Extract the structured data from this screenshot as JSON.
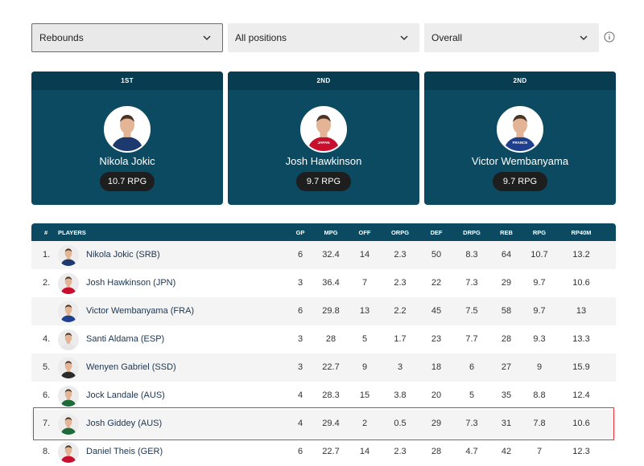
{
  "filters": {
    "stat": "Rebounds",
    "position": "All positions",
    "scope": "Overall"
  },
  "leaders": [
    {
      "rank": "1ST",
      "name": "Nikola Jokic",
      "stat": "10.7 RPG",
      "jersey_color": "#1c3a6e",
      "jersey_text": ""
    },
    {
      "rank": "2ND",
      "name": "Josh Hawkinson",
      "stat": "9.7 RPG",
      "jersey_color": "#c8102e",
      "jersey_text": "JAPAN"
    },
    {
      "rank": "2ND",
      "name": "Victor Wembanyama",
      "stat": "9.7 RPG",
      "jersey_color": "#1f3f8f",
      "jersey_text": "FRANCE"
    }
  ],
  "table": {
    "headers": [
      "#",
      "PLAYERS",
      "GP",
      "MPG",
      "OFF",
      "ORPG",
      "DEF",
      "DRPG",
      "REB",
      "RPG",
      "RP40M"
    ],
    "rows": [
      {
        "rank": "1.",
        "player": "Nikola Jokic (SRB)",
        "gp": "6",
        "mpg": "32.4",
        "off": "14",
        "orpg": "2.3",
        "def": "50",
        "drpg": "8.3",
        "reb": "64",
        "rpg": "10.7",
        "rp40m": "13.2",
        "jersey": "#1c3a6e"
      },
      {
        "rank": "2.",
        "player": "Josh Hawkinson (JPN)",
        "gp": "3",
        "mpg": "36.4",
        "off": "7",
        "orpg": "2.3",
        "def": "22",
        "drpg": "7.3",
        "reb": "29",
        "rpg": "9.7",
        "rp40m": "10.6",
        "jersey": "#c8102e"
      },
      {
        "rank": "",
        "player": "Victor Wembanyama (FRA)",
        "gp": "6",
        "mpg": "29.8",
        "off": "13",
        "orpg": "2.2",
        "def": "45",
        "drpg": "7.5",
        "reb": "58",
        "rpg": "9.7",
        "rp40m": "13",
        "jersey": "#1f3f8f"
      },
      {
        "rank": "4.",
        "player": "Santi Aldama (ESP)",
        "gp": "3",
        "mpg": "28",
        "off": "5",
        "orpg": "1.7",
        "def": "23",
        "drpg": "7.7",
        "reb": "28",
        "rpg": "9.3",
        "rp40m": "13.3",
        "jersey": "#e6e6e6"
      },
      {
        "rank": "5.",
        "player": "Wenyen Gabriel (SSD)",
        "gp": "3",
        "mpg": "22.7",
        "off": "9",
        "orpg": "3",
        "def": "18",
        "drpg": "6",
        "reb": "27",
        "rpg": "9",
        "rp40m": "15.9",
        "jersey": "#2b2b2b"
      },
      {
        "rank": "6.",
        "player": "Jock Landale (AUS)",
        "gp": "4",
        "mpg": "28.3",
        "off": "15",
        "orpg": "3.8",
        "def": "20",
        "drpg": "5",
        "reb": "35",
        "rpg": "8.8",
        "rp40m": "12.4",
        "jersey": "#1e6b3a"
      },
      {
        "rank": "7.",
        "player": "Josh Giddey (AUS)",
        "gp": "4",
        "mpg": "29.4",
        "off": "2",
        "orpg": "0.5",
        "def": "29",
        "drpg": "7.3",
        "reb": "31",
        "rpg": "7.8",
        "rp40m": "10.6",
        "jersey": "#1e6b3a"
      },
      {
        "rank": "8.",
        "player": "Daniel Theis (GER)",
        "gp": "6",
        "mpg": "22.7",
        "off": "14",
        "orpg": "2.3",
        "def": "28",
        "drpg": "4.7",
        "reb": "42",
        "rpg": "7",
        "rp40m": "12.3",
        "jersey": "#c8102e"
      }
    ],
    "highlighted_row": 6
  },
  "icons": {
    "filter_chevron": "chevron-down-icon",
    "info": "info-icon"
  }
}
